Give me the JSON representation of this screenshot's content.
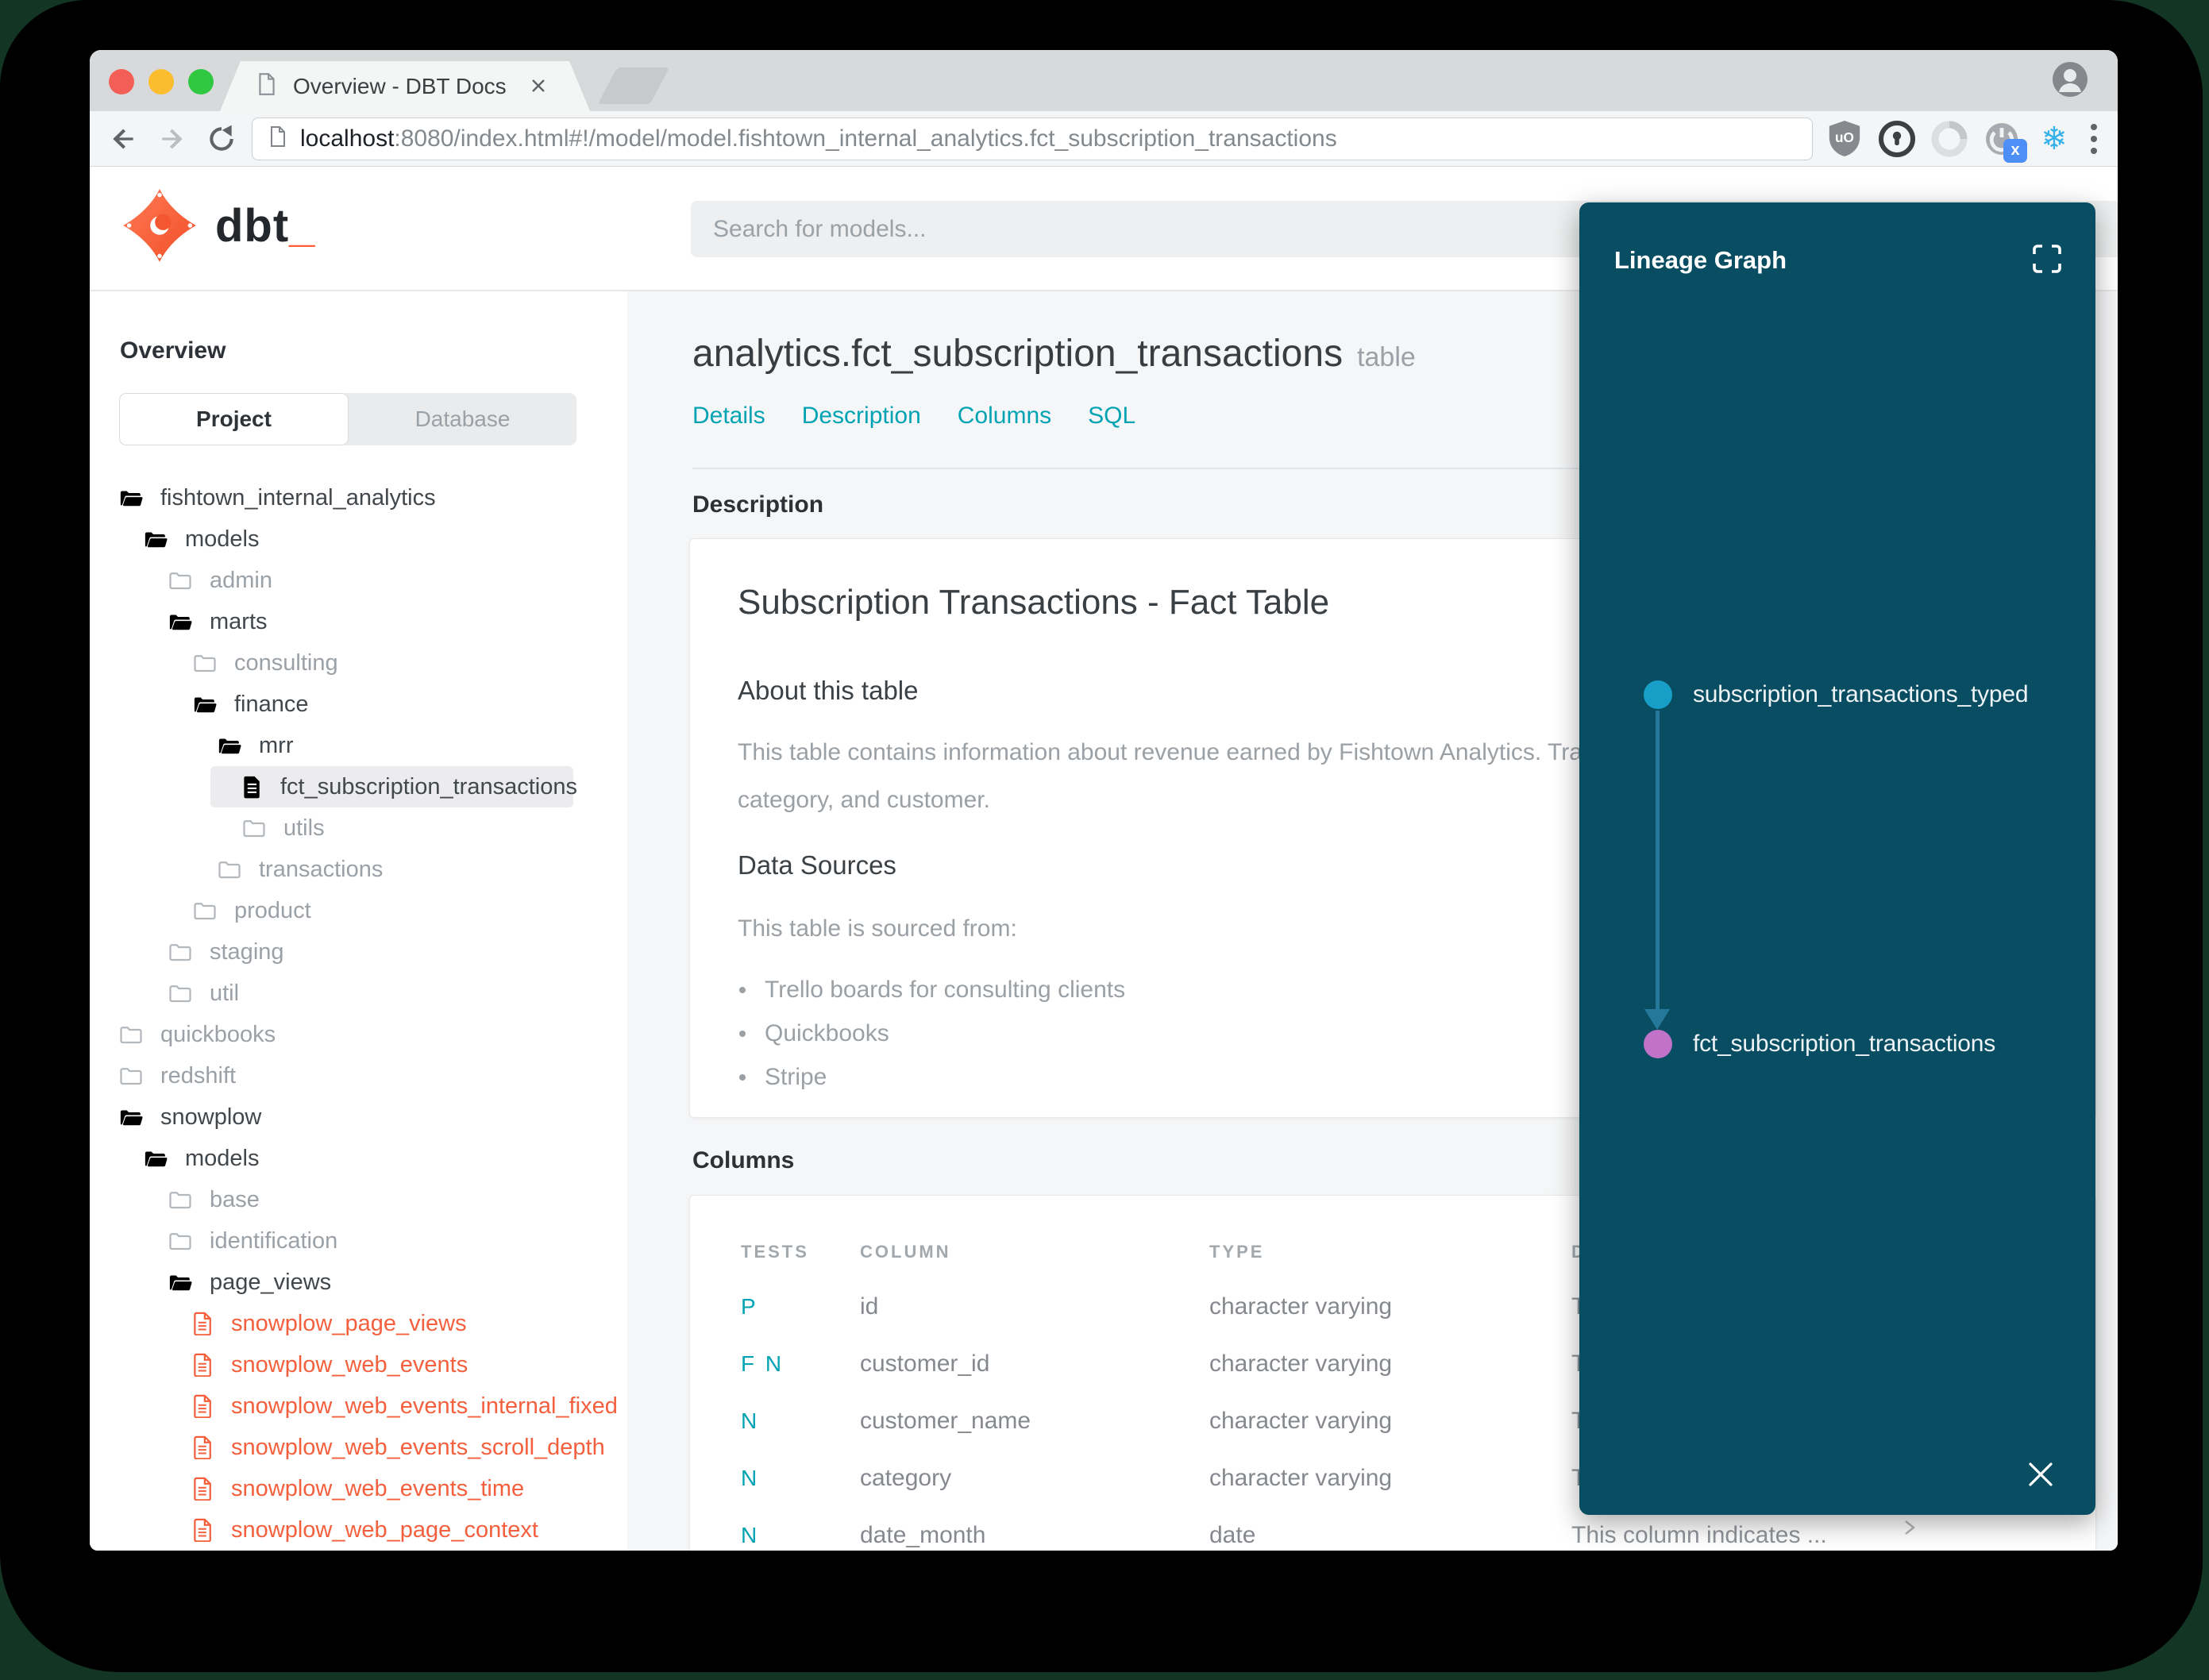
{
  "browser": {
    "tab_title": "Overview - DBT Docs",
    "url_host": "localhost",
    "url_rest": ":8080/index.html#!/model/model.fishtown_internal_analytics.fct_subscription_transactions",
    "ublock_label": "uO",
    "ext_badge": "x",
    "snowflake_glyph": "❄"
  },
  "header": {
    "logo_name": "dbt",
    "logo_cursor": "_",
    "search_placeholder": "Search for models..."
  },
  "sidebar": {
    "heading": "Overview",
    "tabs": {
      "project": "Project",
      "database": "Database"
    },
    "tree": [
      {
        "label": "fishtown_internal_analytics"
      },
      {
        "label": "models"
      },
      {
        "label": "admin"
      },
      {
        "label": "marts"
      },
      {
        "label": "consulting"
      },
      {
        "label": "finance"
      },
      {
        "label": "mrr"
      },
      {
        "label": "fct_subscription_transactions"
      },
      {
        "label": "utils"
      },
      {
        "label": "transactions"
      },
      {
        "label": "product"
      },
      {
        "label": "staging"
      },
      {
        "label": "util"
      },
      {
        "label": "quickbooks"
      },
      {
        "label": "redshift"
      },
      {
        "label": "snowplow"
      },
      {
        "label": "models"
      },
      {
        "label": "base"
      },
      {
        "label": "identification"
      },
      {
        "label": "page_views"
      },
      {
        "label": "snowplow_page_views"
      },
      {
        "label": "snowplow_web_events"
      },
      {
        "label": "snowplow_web_events_internal_fixed"
      },
      {
        "label": "snowplow_web_events_scroll_depth"
      },
      {
        "label": "snowplow_web_events_time"
      },
      {
        "label": "snowplow_web_page_context"
      }
    ]
  },
  "main": {
    "title": "analytics.fct_subscription_transactions",
    "title_badge": "table",
    "nav": [
      "Details",
      "Description",
      "Columns",
      "SQL"
    ],
    "description_header": "Description",
    "doc": {
      "h1": "Subscription Transactions - Fact Table",
      "about_h2": "About this table",
      "about_line1": "This table contains information about revenue earned by Fishtown Analytics. Trans",
      "about_line2": "category, and customer.",
      "sources_h2": "Data Sources",
      "sources_intro": "This table is sourced from:",
      "sources": [
        "Trello boards for consulting clients",
        "Quickbooks",
        "Stripe"
      ]
    },
    "columns_header": "Columns",
    "table": {
      "headers": [
        "TESTS",
        "COLUMN",
        "TYPE",
        "DESCRIPTION"
      ],
      "rows": [
        {
          "tests": "P",
          "column": "id",
          "type": "character varying",
          "description": "This column indicates ..."
        },
        {
          "tests": "F N",
          "column": "customer_id",
          "type": "character varying",
          "description": "This column indicates ..."
        },
        {
          "tests": "N",
          "column": "customer_name",
          "type": "character varying",
          "description": "This column indicates ..."
        },
        {
          "tests": "N",
          "column": "category",
          "type": "character varying",
          "description": "This column indicates ..."
        },
        {
          "tests": "N",
          "column": "date_month",
          "type": "date",
          "description": "This column indicates ..."
        }
      ]
    }
  },
  "lineage": {
    "title": "Lineage Graph",
    "node_top": "subscription_transactions_typed",
    "node_bottom": "fct_subscription_transactions"
  },
  "colors": {
    "accent_teal": "#00a3b3",
    "accent_red": "#f4603e",
    "panel_bg": "#084d62",
    "node_top": "#189fc7",
    "node_bottom": "#c172c9",
    "edge": "#26789b"
  }
}
